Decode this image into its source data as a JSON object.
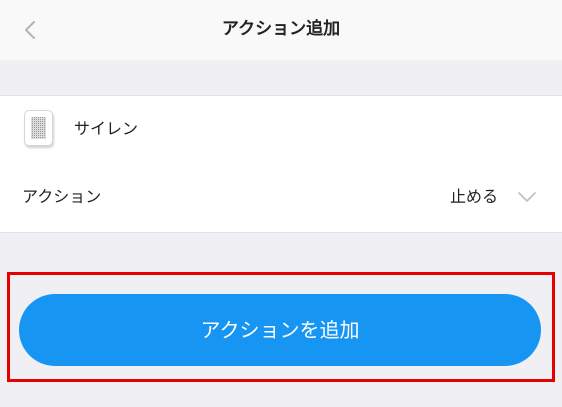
{
  "nav": {
    "title": "アクション追加",
    "back_icon": "chevron-left-icon"
  },
  "device": {
    "icon": "siren-device-icon",
    "name": "サイレン"
  },
  "action": {
    "label": "アクション",
    "value": "止める",
    "dropdown_icon": "chevron-down-icon"
  },
  "primary_button": {
    "label": "アクションを追加",
    "color": "#1795f3"
  },
  "highlight": {
    "color": "#e60000"
  }
}
